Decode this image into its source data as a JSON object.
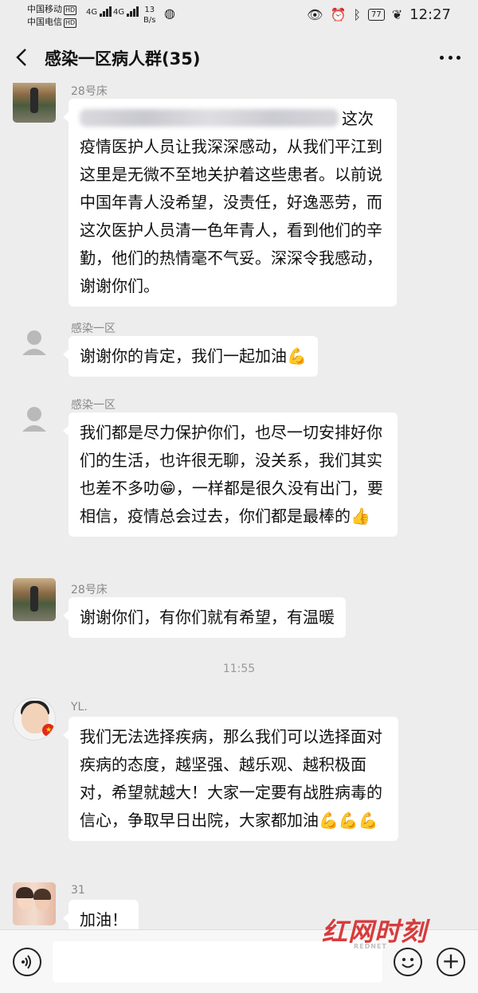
{
  "status_bar": {
    "carrier_1": "中国移动",
    "carrier_2": "中国电信",
    "hd_badge": "HD",
    "net_1": "4G",
    "net_2": "4G",
    "speed_value": "13",
    "speed_unit": "B/s",
    "battery": "77",
    "time": "12:27"
  },
  "header": {
    "title": "感染一区病人群(35)"
  },
  "messages": [
    {
      "sender": "28号床",
      "text_after_blur": "这次疫情医护人员让我深深感动，从我们平江到这里是无微不至地关护着这些患者。以前说中国年青人没希望，没责任，好逸恶劳，而这次医护人员清一色年青人，看到他们的辛勤，他们的热情毫不气妥。深深令我感动，谢谢你们。"
    },
    {
      "sender": "感染一区",
      "text": "谢谢你的肯定，我们一起加油",
      "emoji": "💪"
    },
    {
      "sender": "感染一区",
      "text_part_1": "我们都是尽力保护你们，也尽一切安排好你们的生活，也许很无聊，没关系，我们其实也差不多叻",
      "emoji_1": "😁",
      "text_part_2": "，一样都是很久没有出门，要相信，疫情总会过去，你们都是最棒的",
      "emoji_2": "👍"
    },
    {
      "sender": "28号床",
      "text": "谢谢你们，有你们就有希望，有温暖"
    },
    {
      "sender": "YL.",
      "text": "我们无法选择疾病，那么我们可以选择面对疾病的态度，越坚强、越乐观、越积极面对，希望就越大！大家一定要有战胜病毒的信心，争取早日出院，大家都加油",
      "emoji": "💪💪💪"
    },
    {
      "sender": "31",
      "text": "加油！"
    }
  ],
  "timestamp": "11:55",
  "input_bar": {
    "placeholder": ""
  },
  "watermark": {
    "main": "红网时刻",
    "sub": "REDNET"
  }
}
